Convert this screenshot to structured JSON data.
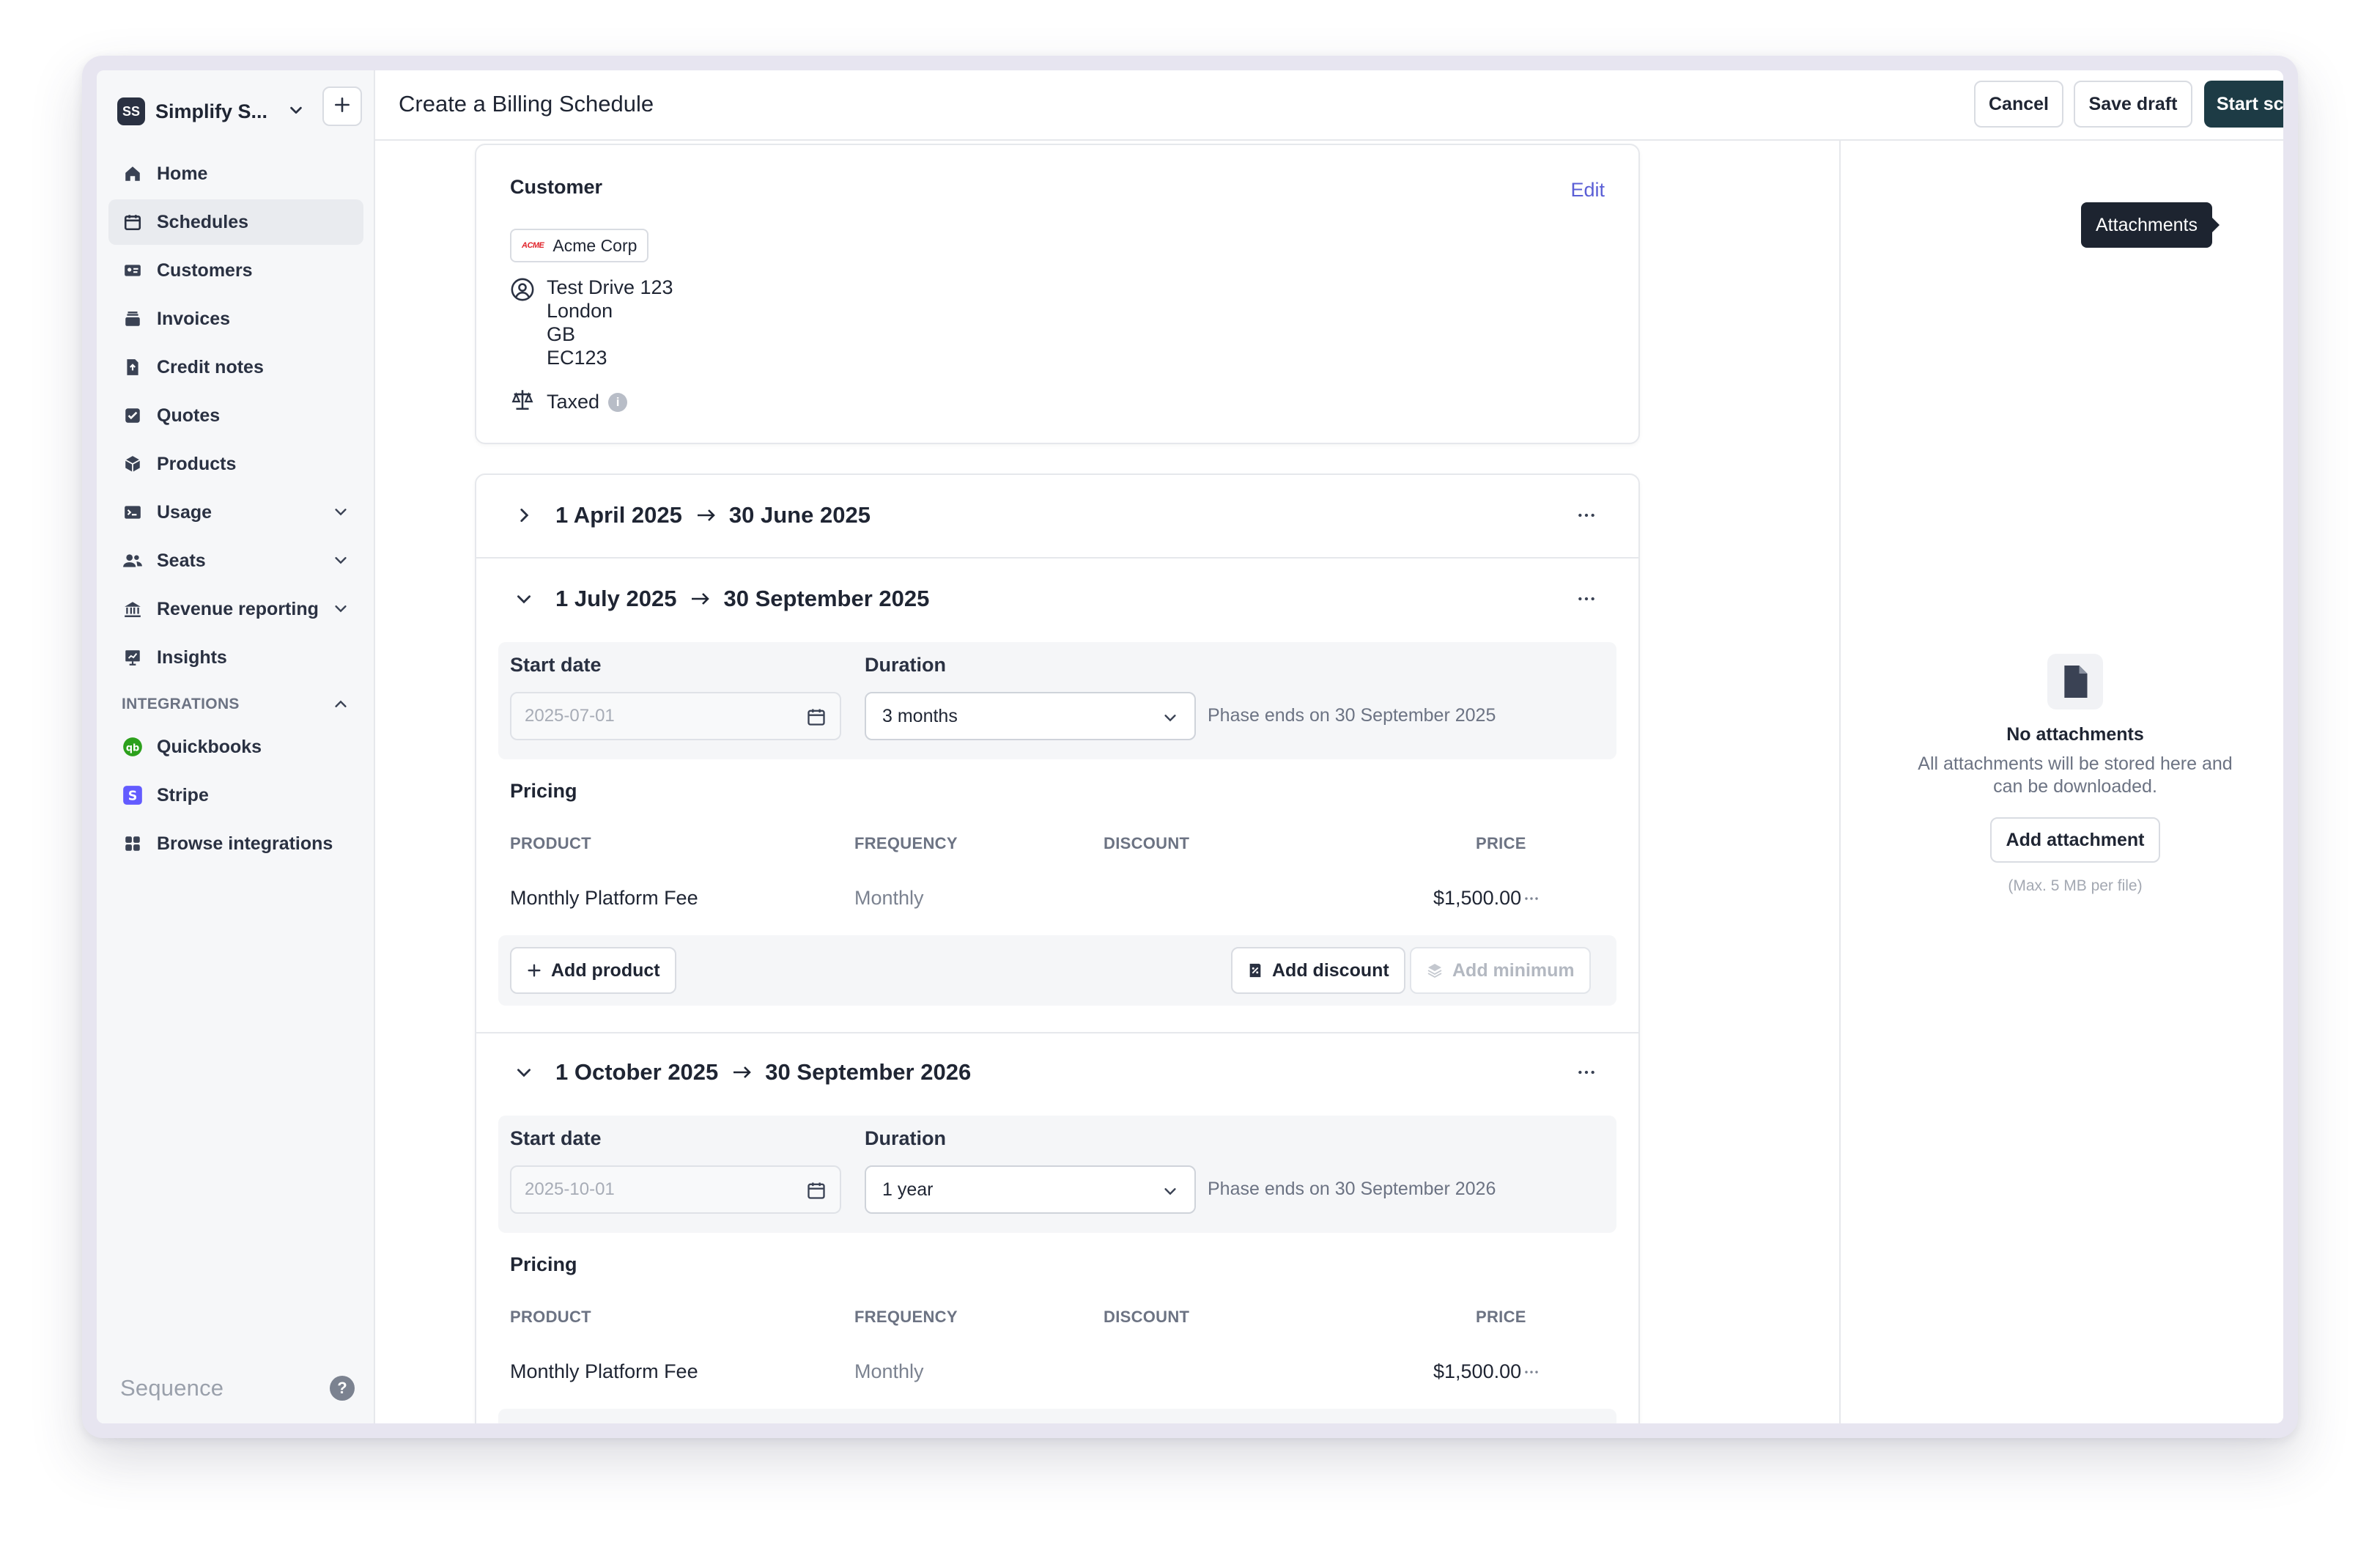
{
  "workspace": {
    "initials": "SS",
    "name": "Simplify S..."
  },
  "sidebar": {
    "items": [
      {
        "label": "Home",
        "icon": "home-icon"
      },
      {
        "label": "Schedules",
        "icon": "calendar-icon"
      },
      {
        "label": "Customers",
        "icon": "id-card-icon"
      },
      {
        "label": "Invoices",
        "icon": "invoice-icon"
      },
      {
        "label": "Credit notes",
        "icon": "credit-note-icon"
      },
      {
        "label": "Quotes",
        "icon": "quote-icon"
      },
      {
        "label": "Products",
        "icon": "cube-icon"
      },
      {
        "label": "Usage",
        "icon": "terminal-icon"
      },
      {
        "label": "Seats",
        "icon": "users-icon"
      },
      {
        "label": "Revenue reporting",
        "icon": "bank-icon"
      },
      {
        "label": "Insights",
        "icon": "chart-icon"
      }
    ],
    "integrations_heading": "INTEGRATIONS",
    "integrations": [
      {
        "label": "Quickbooks",
        "icon": "quickbooks-icon"
      },
      {
        "label": "Stripe",
        "icon": "stripe-icon"
      },
      {
        "label": "Browse integrations",
        "icon": "grid-icon"
      }
    ],
    "brand": "Sequence",
    "help": "?"
  },
  "header": {
    "title": "Create a Billing Schedule",
    "cancel": "Cancel",
    "save_draft": "Save draft",
    "start_schedule": "Start schedule"
  },
  "customer": {
    "heading": "Customer",
    "edit": "Edit",
    "logo_text": "ACME",
    "name": "Acme Corp",
    "address": {
      "line1": "Test Drive 123",
      "line2": "London",
      "line3": "GB",
      "line4": "EC123"
    },
    "tax_status": "Taxed",
    "info": "i"
  },
  "phases": [
    {
      "start": "1 April 2025",
      "end": "30 June 2025",
      "expanded": false
    },
    {
      "start": "1 July 2025",
      "end": "30 September 2025",
      "expanded": true,
      "start_date_label": "Start date",
      "start_date_value": "2025-07-01",
      "duration_label": "Duration",
      "duration": "3 months",
      "phase_ends": "Phase ends on 30 September 2025",
      "pricing_title": "Pricing",
      "columns": [
        "PRODUCT",
        "FREQUENCY",
        "DISCOUNT",
        "PRICE"
      ],
      "rows": [
        {
          "product": "Monthly Platform Fee",
          "frequency": "Monthly",
          "discount": "",
          "price": "$1,500.00"
        }
      ],
      "add_product": "Add product",
      "add_discount": "Add discount",
      "add_minimum": "Add minimum"
    },
    {
      "start": "1 October 2025",
      "end": "30 September 2026",
      "expanded": true,
      "start_date_label": "Start date",
      "start_date_value": "2025-10-01",
      "duration_label": "Duration",
      "duration": "1 year",
      "phase_ends": "Phase ends on 30 September 2026",
      "pricing_title": "Pricing",
      "columns": [
        "PRODUCT",
        "FREQUENCY",
        "DISCOUNT",
        "PRICE"
      ],
      "rows": [
        {
          "product": "Monthly Platform Fee",
          "frequency": "Monthly",
          "discount": "",
          "price": "$1,500.00"
        }
      ]
    }
  ],
  "attachments": {
    "tooltip": "Attachments",
    "stripe_badge": "S",
    "empty_title": "No attachments",
    "empty_desc": "All attachments will be stored here and can be downloaded.",
    "add_button": "Add attachment",
    "max_note": "(Max. 5 MB per file)"
  },
  "colors": {
    "primary_button": "#1d3b45",
    "link": "#5b5fd6",
    "stripe": "#635bff",
    "quickbooks": "#2ca01c"
  }
}
